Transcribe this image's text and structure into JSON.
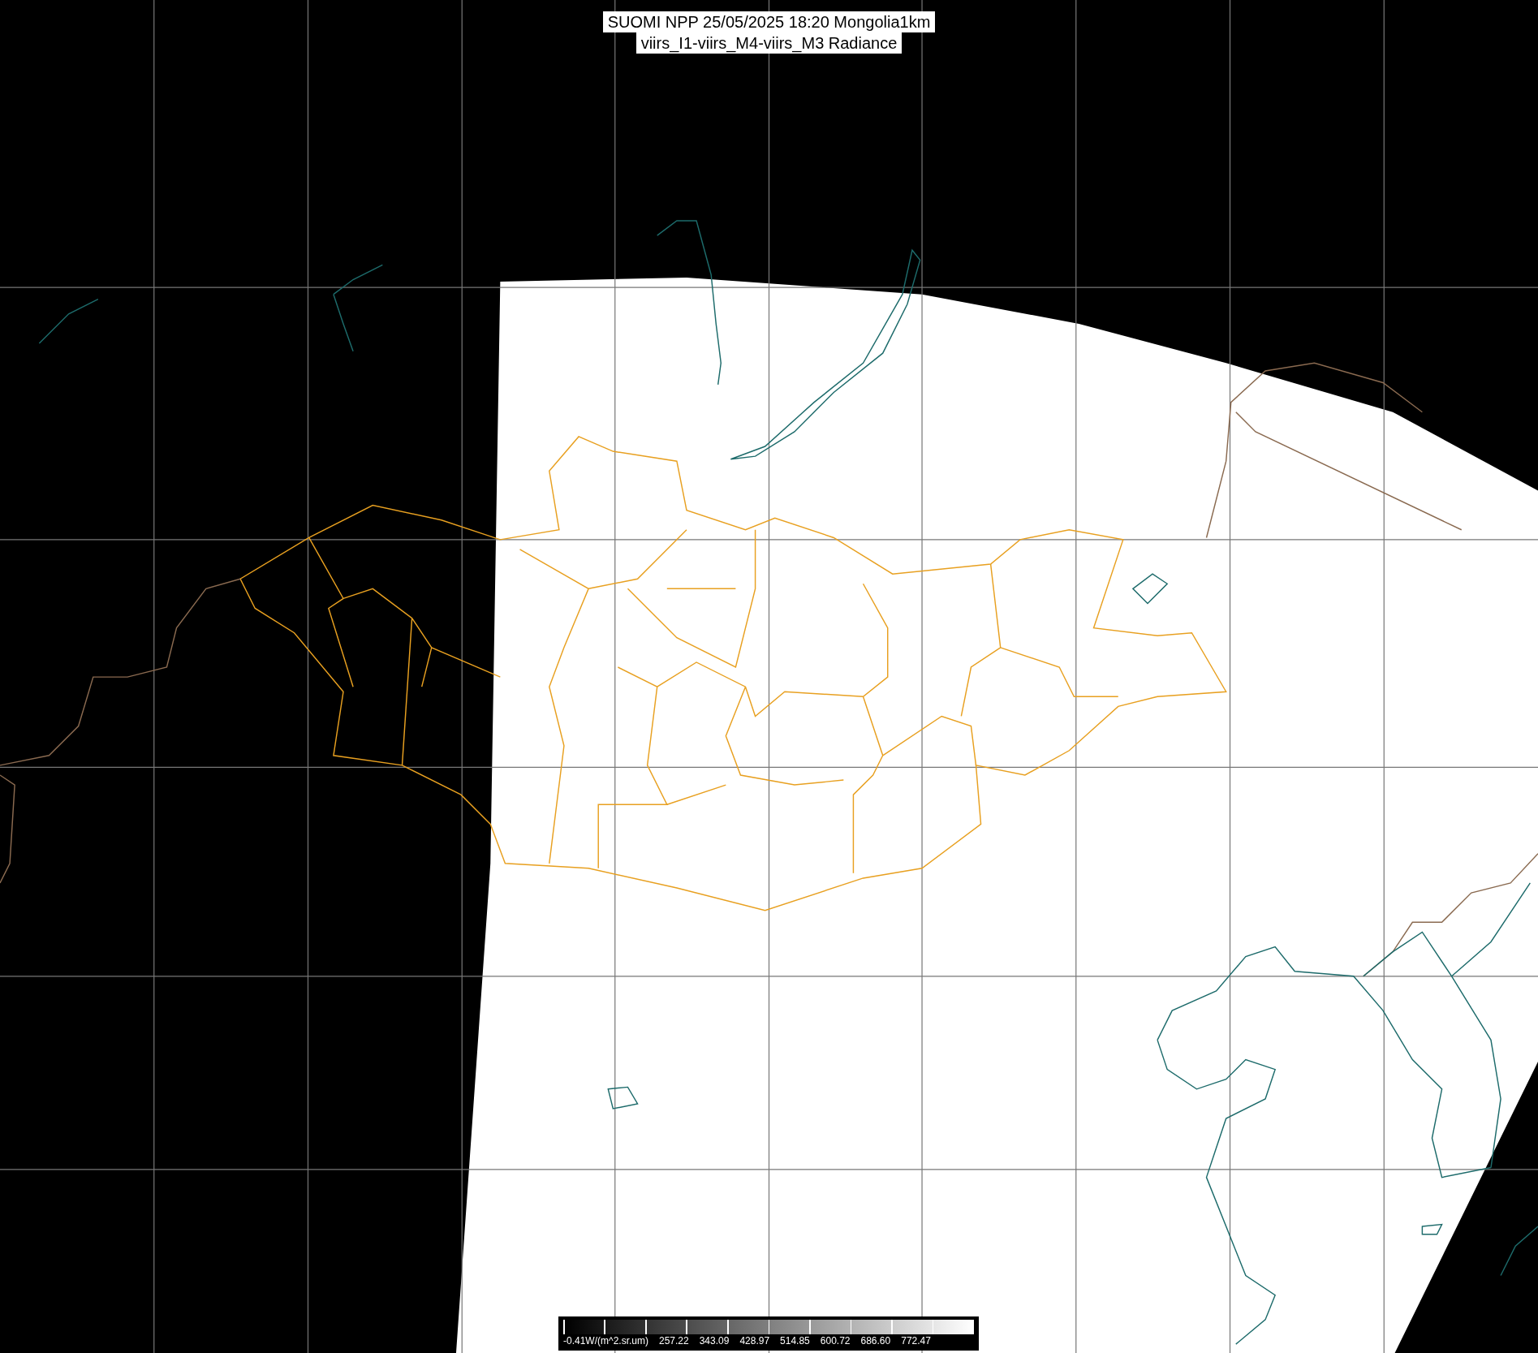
{
  "title": {
    "lines": [
      "SUOMI NPP 25/05/2025 18:20 Mongolia1km",
      "viirs_I1-viirs_M4-viirs_M3 Radiance"
    ]
  },
  "colorbar": {
    "unit_label": "-0.41W/(m^2.sr.um)",
    "tick_labels": [
      "257.22",
      "343.09",
      "428.97",
      "514.85",
      "600.72",
      "686.60",
      "772.47"
    ]
  }
}
